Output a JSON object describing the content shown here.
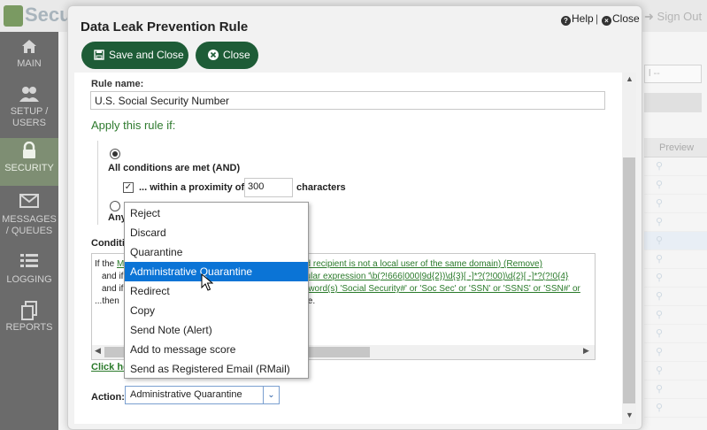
{
  "app": {
    "name": "Secu",
    "sign_out": "Sign Out"
  },
  "sidebar": {
    "items": [
      {
        "label": "MAIN",
        "icon": "home-icon",
        "active": false
      },
      {
        "label": "SETUP / USERS",
        "icon": "users-icon",
        "active": false
      },
      {
        "label": "SECURITY",
        "icon": "lock-icon",
        "active": true
      },
      {
        "label": "MESSAGES / QUEUES",
        "icon": "envelope-icon",
        "active": false
      },
      {
        "label": "LOGGING",
        "icon": "list-icon",
        "active": false
      },
      {
        "label": "REPORTS",
        "icon": "document-icon",
        "active": false
      }
    ]
  },
  "background": {
    "select_value": "l --",
    "table_header": "Preview"
  },
  "modal": {
    "title": "Data Leak Prevention Rule",
    "help": "Help",
    "separator": "|",
    "close_link": "Close",
    "save_button": "Save and Close",
    "close_button": "Close"
  },
  "form": {
    "rule_name_label": "Rule name:",
    "rule_name_value": "U.S. Social Security Number",
    "apply_label": "Apply this rule if:",
    "all_conditions": "All conditions are met (AND)",
    "proximity_label": "... within a proximity of",
    "proximity_value": "300",
    "characters_label": "characters",
    "any_label": "Any",
    "conditions_label": "Conditi",
    "conditions": [
      {
        "prefix": "If the ",
        "link": "M",
        "rest": ""
      },
      {
        "prefix": "",
        "link": "nd recipient is not a local user of the same domain)",
        "rest": "   (Remove)"
      },
      {
        "prefix": "and if",
        "link": "gular expression '\\b(?!666|000|9d{2})\\d{3}[ -]*?(?!00)\\d{2}[ -]*?(?!0{4}",
        "rest": ""
      },
      {
        "prefix": "and if",
        "link": "e word(s) 'Social Security#' or 'Soc Sec' or 'SSN' or 'SSNS' or 'SSN#' or",
        "rest": ""
      },
      {
        "prefix": "...then",
        "link": "",
        "rest": "ine."
      }
    ],
    "click_here": "Click he",
    "action_label": "Action:",
    "action_value": "Administrative Quarantine"
  },
  "dropdown": {
    "options": [
      "Reject",
      "Discard",
      "Quarantine",
      "Administrative Quarantine",
      "Redirect",
      "Copy",
      "Send Note (Alert)",
      "Add to message score",
      "Send as Registered Email (RMail)"
    ],
    "selected": "Administrative Quarantine"
  },
  "colors": {
    "brand_green": "#1e5c37",
    "link_green": "#2a7a2a",
    "highlight": "#0b74d6"
  }
}
